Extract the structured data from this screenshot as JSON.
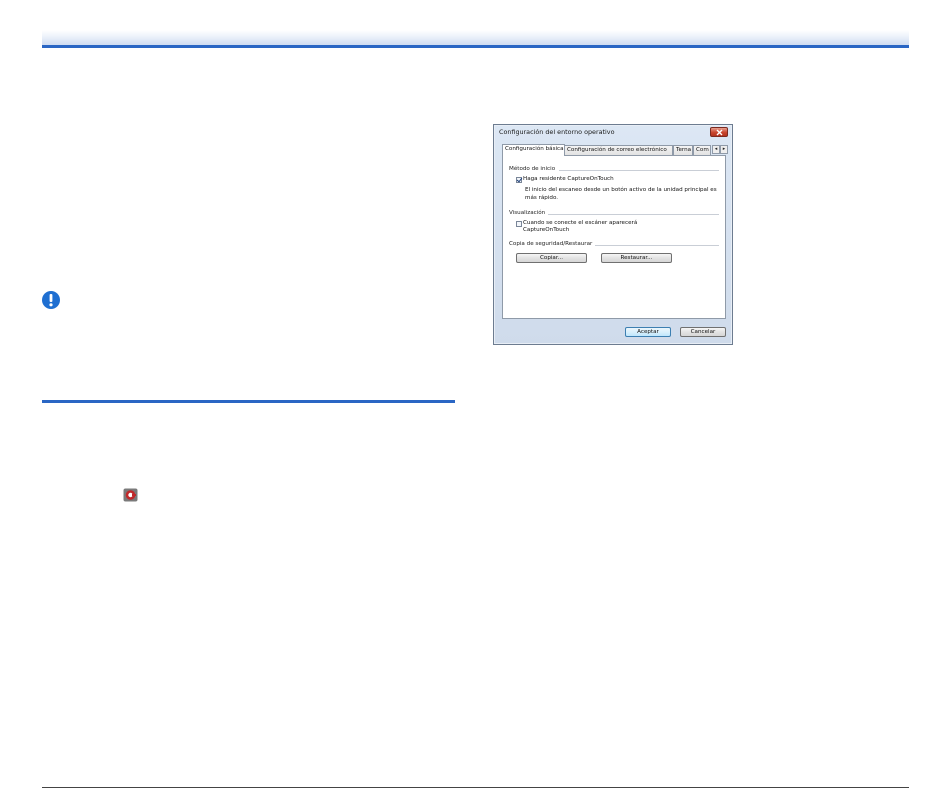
{
  "dialog": {
    "title": "Configuración del entorno operativo",
    "tabs": [
      {
        "label": "Configuración básica",
        "active": true
      },
      {
        "label": "Configuración de correo electrónico",
        "active": false
      },
      {
        "label": "Terna",
        "active": false
      },
      {
        "label": "Com",
        "active": false
      }
    ],
    "tab_scroll_left": "◂",
    "tab_scroll_right": "▸",
    "start_method": {
      "group_label": "Método de inicio",
      "checkbox_label": "Haga residente CaptureOnTouch",
      "checked": true,
      "description": "El inicio del escaneo desde un botón activo de la unidad principal es más rápido."
    },
    "display": {
      "group_label": "Visualización",
      "checkbox_label": "Cuando se conecte el escáner aparecerá CaptureOnTouch",
      "checked": false
    },
    "backup": {
      "group_label": "Copia de seguridad/Restaurar",
      "copy_button": "Copiar...",
      "restore_button": "Restaurar..."
    },
    "ok_button": "Aceptar",
    "cancel_button": "Cancelar"
  },
  "colors": {
    "accent_rule": "#2a66c4",
    "note_icon": "#1f6fd1",
    "app_icon": "#c0282a"
  },
  "icons": {
    "note": "important-note-icon",
    "app": "captureontouch-app-icon"
  }
}
